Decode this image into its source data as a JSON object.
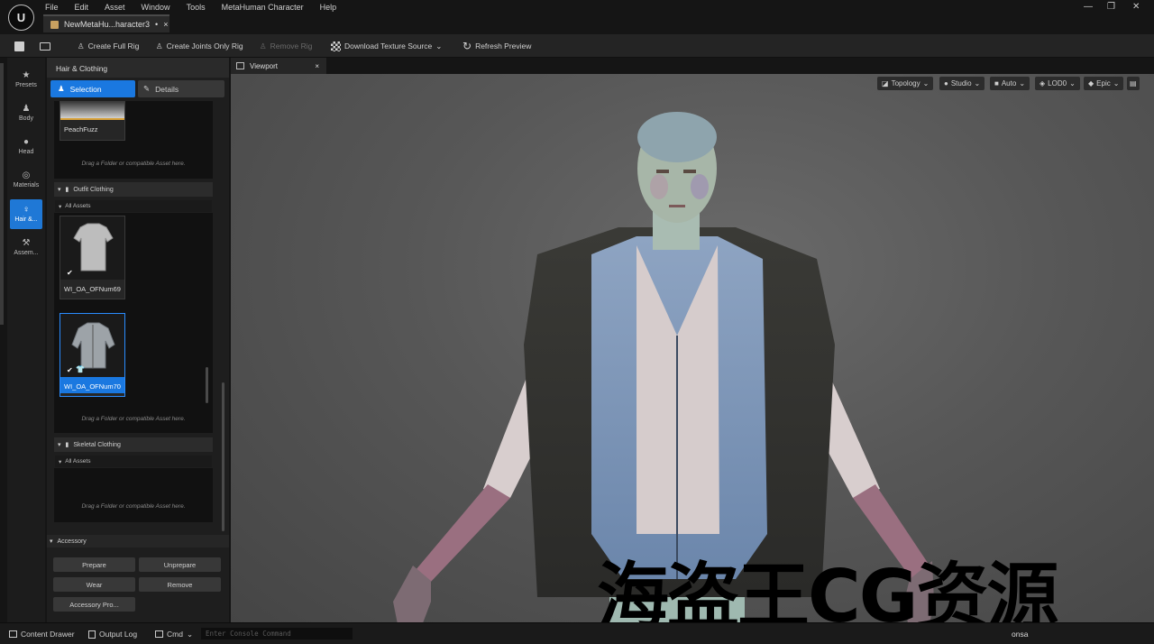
{
  "menu": [
    "File",
    "Edit",
    "Asset",
    "Window",
    "Tools",
    "MetaHuman Character",
    "Help"
  ],
  "tab": {
    "title": "NewMetaHu...haracter3",
    "modified": "•",
    "close": "×"
  },
  "toolbar": {
    "create_full_rig": "Create Full Rig",
    "create_joints_only_rig": "Create Joints Only Rig",
    "remove_rig": "Remove Rig",
    "download_texture_source": "Download Texture Source",
    "refresh_preview": "Refresh Preview"
  },
  "nav": [
    {
      "label": "Presets",
      "icon": "star-icon"
    },
    {
      "label": "Body",
      "icon": "body-icon"
    },
    {
      "label": "Head",
      "icon": "head-icon"
    },
    {
      "label": "Materials",
      "icon": "materials-icon"
    },
    {
      "label": "Hair &...",
      "icon": "hair-icon",
      "active": true
    },
    {
      "label": "Assem...",
      "icon": "hammer-icon"
    }
  ],
  "panel": {
    "title": "Hair & Clothing",
    "selection": "Selection",
    "details": "Details",
    "peachfuzz_label": "PeachFuzz",
    "drag_hint": "Drag a Folder or compatible Asset here.",
    "outfit_clothing": "Outfit Clothing",
    "all_assets": "All Assets",
    "asset1": "WI_OA_OFNum69",
    "asset2": "WI_OA_OFNum70",
    "skeletal_clothing": "Skeletal Clothing",
    "accessory": "Accessory",
    "prepare": "Prepare",
    "unprepare": "Unprepare",
    "wear": "Wear",
    "remove": "Remove",
    "accessory_props": "Accessory Pro..."
  },
  "viewport": {
    "tab": "Viewport",
    "close": "×",
    "topology": "Topology",
    "studio": "Studio",
    "auto": "Auto",
    "lod": "LOD0",
    "epic": "Epic"
  },
  "status": {
    "content_drawer": "Content Drawer",
    "output_log": "Output Log",
    "cmd": "Cmd",
    "console_placeholder": "Enter Console Command",
    "consa": "onsa"
  },
  "watermark": "海盗王CG资源",
  "colors": {
    "accent": "#1a78e0",
    "background": "#151515",
    "panel": "#1e1e1e"
  }
}
